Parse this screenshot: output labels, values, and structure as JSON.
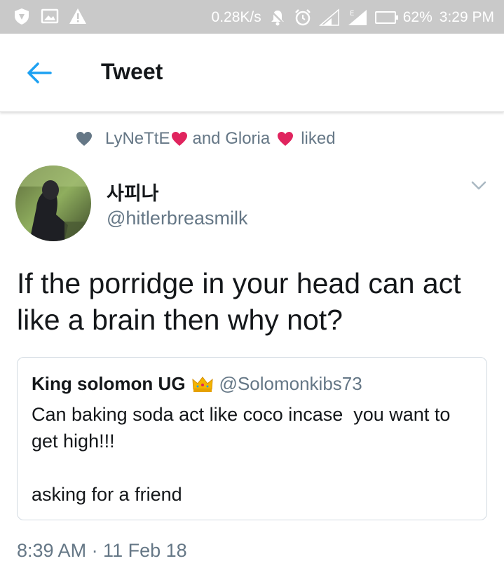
{
  "status_bar": {
    "network_speed": "0.28K/s",
    "battery": "62%",
    "time": "3:29 PM",
    "icons": [
      "shield-icon",
      "image-icon",
      "warning-icon",
      "mute-icon",
      "alarm-icon",
      "signal-icon",
      "signal-e-icon",
      "battery-icon"
    ]
  },
  "app_bar": {
    "title": "Tweet"
  },
  "liked": {
    "user1": "LyNeTtE",
    "connector": "and Gloria",
    "suffix": "liked"
  },
  "tweet": {
    "display_name": "사피나",
    "username": "@hitlerbreasmilk",
    "text": "If the porridge in your head can act like a brain then why not?",
    "timestamp": "8:39 AM · 11 Feb 18"
  },
  "quoted_tweet": {
    "display_name": "King solomon UG",
    "username": "@Solomonkibs73",
    "text": "Can baking soda act like coco incase  you want to get high!!!\n\nasking for a friend"
  },
  "colors": {
    "accent": "#1da1f2",
    "heart": "#e0245e",
    "secondary_text": "#657786",
    "status_bar": "#c9c9c9"
  }
}
